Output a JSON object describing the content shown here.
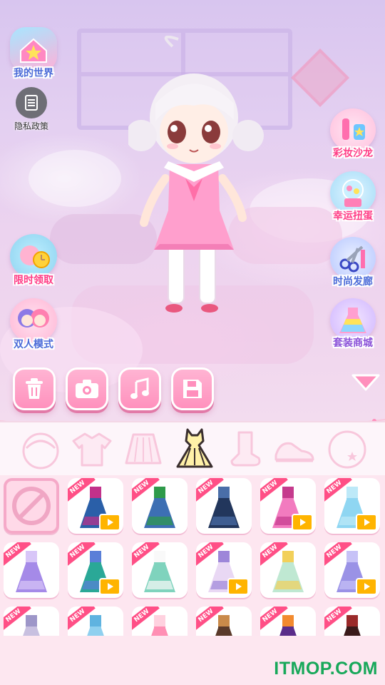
{
  "left_menu": {
    "my_world": "我的世界",
    "privacy": "隐私政策",
    "limited_claim": "限时领取",
    "two_player": "双人模式"
  },
  "right_menu": {
    "makeup_salon": "彩妆沙龙",
    "lucky_gashapon": "幸运扭蛋",
    "hair_salon": "时尚发廊",
    "outfit_mall": "套装商城"
  },
  "toolbar": [
    "delete-icon",
    "camera-icon",
    "music-icon",
    "save-icon"
  ],
  "categories": [
    "face",
    "top",
    "skirt",
    "dress",
    "socks",
    "shoes",
    "accessory"
  ],
  "selected_category": "dress",
  "new_label": "NEW",
  "items": [
    {
      "kind": "none",
      "new": false,
      "video": false
    },
    {
      "color": "#2a5fa8",
      "accent": "#c2318a",
      "new": true,
      "video": true
    },
    {
      "color": "#3d6fb3",
      "accent": "#2e9a4a",
      "new": true,
      "video": false
    },
    {
      "color": "#22365c",
      "accent": "#4a6ea8",
      "new": true,
      "video": false
    },
    {
      "color": "#f27bbf",
      "accent": "#c53b8d",
      "new": true,
      "video": true
    },
    {
      "color": "#8fd6f2",
      "accent": "#bde9f8",
      "new": true,
      "video": true
    },
    {
      "color": "#a58ae8",
      "accent": "#d8c6f8",
      "new": true,
      "video": false
    },
    {
      "color": "#2aa897",
      "accent": "#5a7fd8",
      "new": true,
      "video": true
    },
    {
      "color": "#7fd3bd",
      "accent": "#f9f9f9",
      "new": true,
      "video": false
    },
    {
      "color": "#e9d8f4",
      "accent": "#9d86d9",
      "new": true,
      "video": true
    },
    {
      "color": "#bfe8d2",
      "accent": "#f2d05a",
      "new": true,
      "video": false
    },
    {
      "color": "#9a92e6",
      "accent": "#c7c2f7",
      "new": true,
      "video": true
    },
    {
      "color": "#c8c0e0",
      "accent": "#9d96c8",
      "new": true,
      "video": false
    },
    {
      "color": "#8fd0ef",
      "accent": "#5fb3e0",
      "new": true,
      "video": false
    },
    {
      "color": "#ff8fb4",
      "accent": "#ffd1df",
      "new": true,
      "video": false
    },
    {
      "color": "#5a3a2a",
      "accent": "#c98a4a",
      "new": true,
      "video": false
    },
    {
      "color": "#5a2d8a",
      "accent": "#f28a2e",
      "new": true,
      "video": false
    },
    {
      "color": "#3a1a1a",
      "accent": "#9a2a2a",
      "new": true,
      "video": false
    }
  ],
  "watermark": "ITMOP.COM"
}
